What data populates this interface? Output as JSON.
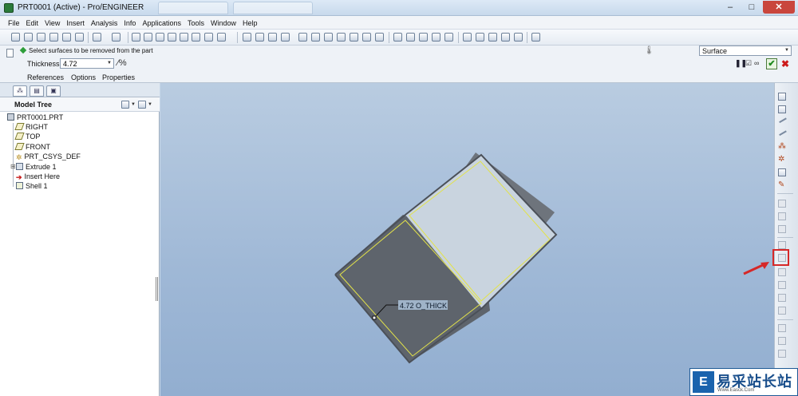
{
  "window": {
    "title": "PRT0001 (Active) - Pro/ENGINEER",
    "controls": [
      "–",
      "□",
      "✕"
    ]
  },
  "menu": [
    "File",
    "Edit",
    "View",
    "Insert",
    "Analysis",
    "Info",
    "Applications",
    "Tools",
    "Window",
    "Help"
  ],
  "dashboard": {
    "message": "Select surfaces to be removed from the part",
    "thickness_label": "Thickness",
    "thickness_value": "4.72",
    "tabs": [
      "References",
      "Options",
      "Properties"
    ],
    "filter_value": "Surface",
    "ok_glyph": "✔",
    "cancel_glyph": "✖",
    "pause_glyph": "❚❚"
  },
  "model_tree": {
    "title": "Model Tree",
    "items": [
      {
        "label": "PRT0001.PRT",
        "icon": "part-icon"
      },
      {
        "label": "RIGHT",
        "icon": "datum-plane-icon"
      },
      {
        "label": "TOP",
        "icon": "datum-plane-icon"
      },
      {
        "label": "FRONT",
        "icon": "datum-plane-icon"
      },
      {
        "label": "PRT_CSYS_DEF",
        "icon": "csys-icon"
      },
      {
        "label": "Extrude 1",
        "icon": "extrude-icon"
      },
      {
        "label": "Insert Here",
        "icon": "insert-here-icon"
      },
      {
        "label": "Shell 1",
        "icon": "shell-icon"
      }
    ]
  },
  "graphics": {
    "dimension_label": "4.72 O_THICK",
    "model_colors": {
      "face_dark": "#5e646c",
      "face_light": "#c9d4df",
      "edge_highlight": "#e2e24a"
    }
  },
  "watermark": {
    "logo_glyph": "E",
    "text": "易采站长站",
    "subtext": "Www.Easck.Com"
  },
  "colors": {
    "accent_red": "#d62828",
    "ok_green": "#1e8a1e"
  }
}
